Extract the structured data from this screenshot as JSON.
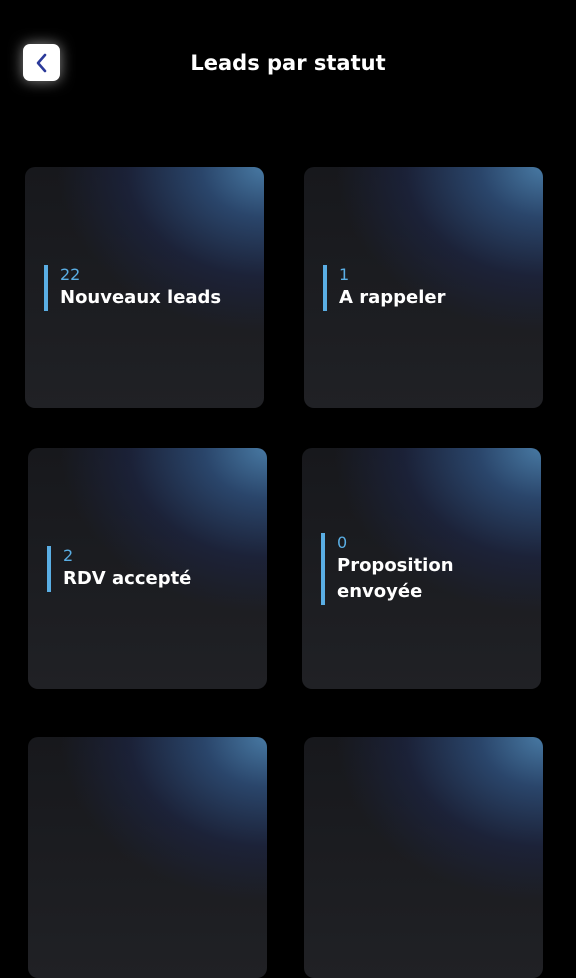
{
  "header": {
    "title": "Leads par statut",
    "back_icon": "chevron-left-icon"
  },
  "colors": {
    "background": "#000000",
    "accent": "#5aaee4",
    "card_glow": "#4a7eaa",
    "back_button_bg": "#ffffff",
    "back_icon": "#2b3a9a"
  },
  "cards": [
    {
      "count": "22",
      "label": "Nouveaux leads"
    },
    {
      "count": "1",
      "label": "A rappeler"
    },
    {
      "count": "2",
      "label": "RDV accepté"
    },
    {
      "count": "0",
      "label_line1": "Proposition",
      "label_line2": "envoyée"
    },
    {},
    {}
  ]
}
